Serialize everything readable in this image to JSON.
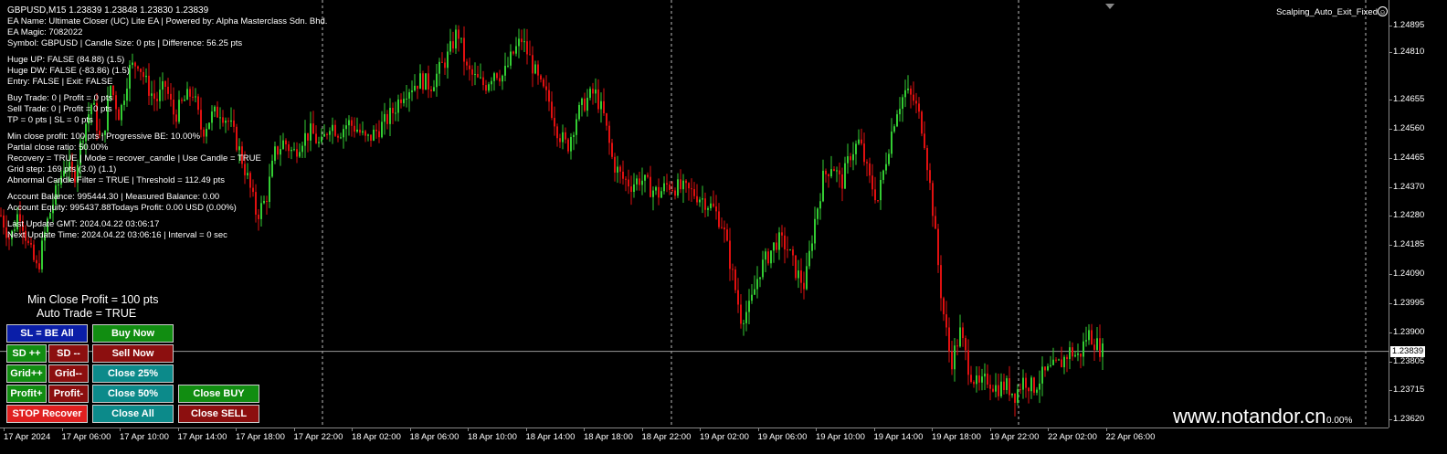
{
  "symbol_line": "GBPUSD,M15  1.23839 1.23848 1.23830 1.23839",
  "info_lines": [
    "EA Name: Ultimate Closer (UC) Lite EA | Powered by: Alpha Masterclass Sdn. Bhd.",
    "EA Magic: 7082022",
    "Symbol: GBPUSD | Candle Size: 0 pts | Difference: 56.25 pts",
    "",
    "Huge UP: FALSE (84.88) (1.5)",
    "Huge DW: FALSE (-83.86) (1.5)",
    "Entry: FALSE | Exit:  FALSE",
    "",
    "Buy Trade: 0 | Profit = 0 pts",
    "Sell Trade: 0 | Profit = 0 pts",
    "TP = 0 pts | SL = 0 pts",
    "",
    "Min close profit: 100 pts | Progressive BE: 10.00%",
    "Partial close ratio: 50.00%",
    "Recovery = TRUE | Mode = recover_candle | Use Candle = TRUE",
    "Grid step: 169 pts (3.0) (1.1)",
    "Abnormal Candle Filter = TRUE | Threshold = 112.49 pts",
    "",
    "Account Balance: 995444.30 | Measured Balance: 0.00",
    "Account Equity: 995437.88Todays Profit:   0.00 USD (0.00%)",
    "",
    "Last Update GMT: 2024.04.22 03:06:17",
    "Next Update Time: 2024.04.22 03:06:16 | Interval = 0 sec"
  ],
  "panel": {
    "min_close_profit": "Min Close Profit = 100 pts",
    "auto_trade": "Auto Trade = TRUE"
  },
  "buttons": {
    "sl_be_all": "SL = BE All",
    "buy_now": "Buy Now",
    "sd_plus": "SD ++",
    "sd_minus": "SD --",
    "sell_now": "Sell Now",
    "grid_plus": "Grid++",
    "grid_minus": "Grid--",
    "close_25": "Close 25%",
    "profit_plus": "Profit+",
    "profit_minus": "Profit-",
    "close_50": "Close 50%",
    "close_buy": "Close BUY",
    "stop_recover": "STOP Recover",
    "close_all": "Close All",
    "close_sell": "Close SELL"
  },
  "indicator_name": "Scalping_Auto_Exit_Fixed",
  "watermark": "www.notandor.cn",
  "percent_label": "0.00%",
  "current_price": "1.23839",
  "price_ticks": [
    "1.24895",
    "1.24810",
    "1.24655",
    "1.24560",
    "1.24465",
    "1.24370",
    "1.24280",
    "1.24185",
    "1.24090",
    "1.23995",
    "1.23900",
    "1.23805",
    "1.23715",
    "1.23620"
  ],
  "time_ticks": [
    "17 Apr 2024",
    "17 Apr 06:00",
    "17 Apr 10:00",
    "17 Apr 14:00",
    "17 Apr 18:00",
    "17 Apr 22:00",
    "18 Apr 02:00",
    "18 Apr 06:00",
    "18 Apr 10:00",
    "18 Apr 14:00",
    "18 Apr 18:00",
    "18 Apr 22:00",
    "19 Apr 02:00",
    "19 Apr 06:00",
    "19 Apr 10:00",
    "19 Apr 14:00",
    "19 Apr 18:00",
    "19 Apr 22:00",
    "22 Apr 02:00",
    "22 Apr 06:00"
  ],
  "colors": {
    "bull": "#33cc33",
    "bear": "#e01010",
    "background": "#000000"
  },
  "chart_data": {
    "type": "candlestick",
    "symbol": "GBPUSD",
    "timeframe": "M15",
    "ylim": [
      1.2361,
      1.2496
    ],
    "current_price": 1.23839,
    "close_path": [
      [
        0,
        1.2428
      ],
      [
        10,
        1.242
      ],
      [
        20,
        1.243
      ],
      [
        30,
        1.2418
      ],
      [
        40,
        1.241
      ],
      [
        50,
        1.2425
      ],
      [
        60,
        1.2435
      ],
      [
        70,
        1.2445
      ],
      [
        80,
        1.244
      ],
      [
        90,
        1.2455
      ],
      [
        100,
        1.2465
      ],
      [
        110,
        1.245
      ],
      [
        120,
        1.247
      ],
      [
        130,
        1.246
      ],
      [
        140,
        1.2475
      ],
      [
        150,
        1.2478
      ],
      [
        160,
        1.247
      ],
      [
        170,
        1.2465
      ],
      [
        180,
        1.247
      ],
      [
        190,
        1.246
      ],
      [
        200,
        1.2465
      ],
      [
        210,
        1.2468
      ],
      [
        220,
        1.2455
      ],
      [
        230,
        1.246
      ],
      [
        240,
        1.2462
      ],
      [
        250,
        1.2458
      ],
      [
        260,
        1.245
      ],
      [
        270,
        1.244
      ],
      [
        280,
        1.2428
      ],
      [
        290,
        1.2433
      ],
      [
        300,
        1.2448
      ],
      [
        310,
        1.2452
      ],
      [
        320,
        1.2448
      ],
      [
        330,
        1.2453
      ],
      [
        340,
        1.2455
      ],
      [
        350,
        1.245
      ],
      [
        360,
        1.2458
      ],
      [
        370,
        1.2455
      ],
      [
        380,
        1.2458
      ],
      [
        390,
        1.2456
      ],
      [
        400,
        1.2452
      ],
      [
        410,
        1.2455
      ],
      [
        420,
        1.2458
      ],
      [
        430,
        1.2462
      ],
      [
        440,
        1.2468
      ],
      [
        450,
        1.247
      ],
      [
        460,
        1.2472
      ],
      [
        470,
        1.247
      ],
      [
        480,
        1.2475
      ],
      [
        490,
        1.248
      ],
      [
        500,
        1.2488
      ],
      [
        510,
        1.2475
      ],
      [
        520,
        1.2472
      ],
      [
        530,
        1.247
      ],
      [
        540,
        1.2475
      ],
      [
        550,
        1.2473
      ],
      [
        560,
        1.248
      ],
      [
        570,
        1.2485
      ],
      [
        580,
        1.2478
      ],
      [
        590,
        1.247
      ],
      [
        600,
        1.2465
      ],
      [
        610,
        1.2455
      ],
      [
        620,
        1.245
      ],
      [
        630,
        1.246
      ],
      [
        640,
        1.2465
      ],
      [
        650,
        1.2468
      ],
      [
        660,
        1.246
      ],
      [
        670,
        1.2445
      ],
      [
        680,
        1.244
      ],
      [
        690,
        1.2438
      ],
      [
        700,
        1.244
      ],
      [
        710,
        1.2437
      ],
      [
        720,
        1.2435
      ],
      [
        730,
        1.2438
      ],
      [
        740,
        1.2437
      ],
      [
        750,
        1.2436
      ],
      [
        760,
        1.2435
      ],
      [
        770,
        1.2433
      ],
      [
        780,
        1.243
      ],
      [
        790,
        1.2425
      ],
      [
        800,
        1.241
      ],
      [
        810,
        1.2395
      ],
      [
        820,
        1.2398
      ],
      [
        830,
        1.241
      ],
      [
        840,
        1.2415
      ],
      [
        850,
        1.242
      ],
      [
        860,
        1.2418
      ],
      [
        870,
        1.241
      ],
      [
        880,
        1.2405
      ],
      [
        890,
        1.2425
      ],
      [
        900,
        1.244
      ],
      [
        910,
        1.2445
      ],
      [
        920,
        1.2438
      ],
      [
        930,
        1.2448
      ],
      [
        940,
        1.2452
      ],
      [
        950,
        1.244
      ],
      [
        960,
        1.2433
      ],
      [
        970,
        1.2448
      ],
      [
        980,
        1.2462
      ],
      [
        990,
        1.2468
      ],
      [
        1000,
        1.2465
      ],
      [
        1010,
        1.2455
      ],
      [
        1020,
        1.243
      ],
      [
        1030,
        1.24
      ],
      [
        1040,
        1.238
      ],
      [
        1050,
        1.239
      ],
      [
        1060,
        1.2378
      ],
      [
        1070,
        1.2372
      ],
      [
        1080,
        1.2375
      ],
      [
        1090,
        1.2372
      ],
      [
        1100,
        1.2373
      ],
      [
        1110,
        1.237
      ],
      [
        1120,
        1.2375
      ],
      [
        1130,
        1.2372
      ],
      [
        1140,
        1.2376
      ],
      [
        1150,
        1.2378
      ],
      [
        1160,
        1.238
      ],
      [
        1170,
        1.2384
      ],
      [
        1180,
        1.2382
      ],
      [
        1190,
        1.239
      ],
      [
        1200,
        1.2386
      ],
      [
        1206,
        1.23839
      ]
    ]
  }
}
